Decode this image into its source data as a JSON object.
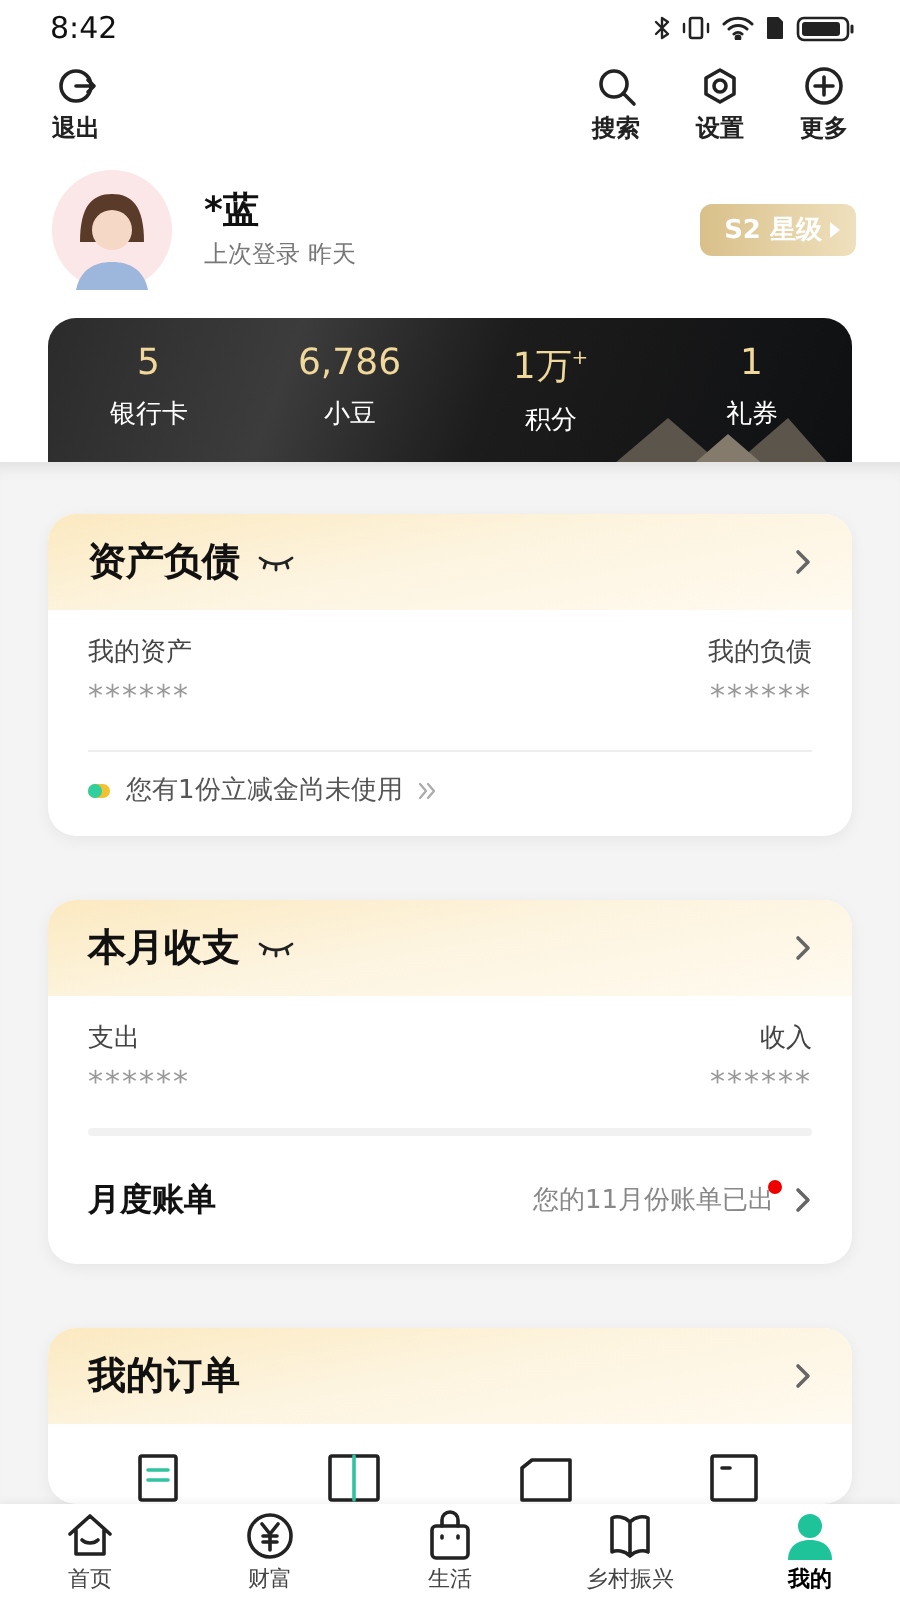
{
  "status_bar": {
    "time": "8:42"
  },
  "toolbar": {
    "left": [
      {
        "label": "退出",
        "kind": "logout"
      }
    ],
    "right": [
      {
        "label": "搜索",
        "kind": "search"
      },
      {
        "label": "设置",
        "kind": "settings"
      },
      {
        "label": "更多",
        "kind": "more"
      }
    ]
  },
  "profile": {
    "name": "*蓝",
    "last_login": "上次登录 昨天",
    "level_badge": "S2 星级"
  },
  "stats": [
    {
      "value": "5",
      "label": "银行卡"
    },
    {
      "value": "6,786",
      "label": "小豆"
    },
    {
      "value": "1万$^{+}$",
      "label": "积分"
    },
    {
      "value": "1",
      "label": "礼券"
    }
  ],
  "assets_card": {
    "title": "资产负债",
    "amounts_hidden": true,
    "left_label": "我的资产",
    "left_value": "******",
    "right_label": "我的负债",
    "right_value": "******",
    "promo": "您有1份立减金尚未使用"
  },
  "monthly_card": {
    "title": "本月收支",
    "amounts_hidden": true,
    "left_label": "支出",
    "left_value": "******",
    "right_label": "收入",
    "right_value": "******",
    "bill_title": "月度账单",
    "bill_note": "您的11月份账单已出",
    "unread": true
  },
  "orders_card": {
    "title": "我的订单",
    "items": [
      {
        "kind": "receipt"
      },
      {
        "kind": "grid"
      },
      {
        "kind": "folder"
      },
      {
        "kind": "document"
      }
    ]
  },
  "tab_bar": [
    {
      "label": "首页",
      "kind": "home",
      "selected": false
    },
    {
      "label": "财富",
      "kind": "wealth",
      "selected": false
    },
    {
      "label": "生活",
      "kind": "life",
      "selected": false
    },
    {
      "label": "乡村振兴",
      "kind": "rural",
      "selected": false
    },
    {
      "label": "我的",
      "kind": "me",
      "selected": true
    }
  ]
}
